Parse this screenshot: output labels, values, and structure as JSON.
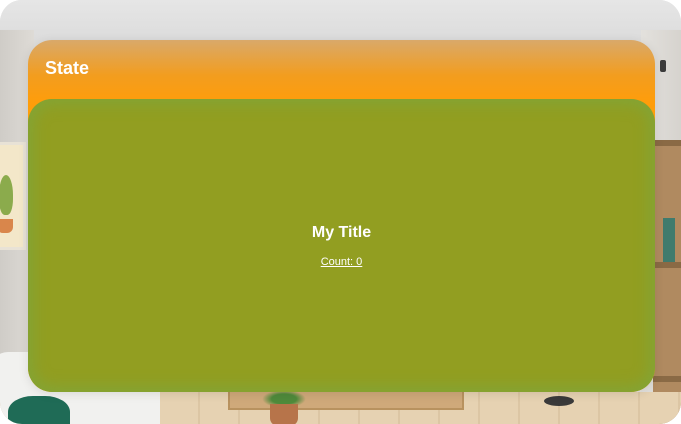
{
  "window": {
    "title": "State"
  },
  "content": {
    "title": "My Title",
    "count_label": "Count: 0"
  },
  "colors": {
    "header_accent": "#ff9d0a",
    "card_background": "#929e21",
    "text": "#ffffff"
  }
}
